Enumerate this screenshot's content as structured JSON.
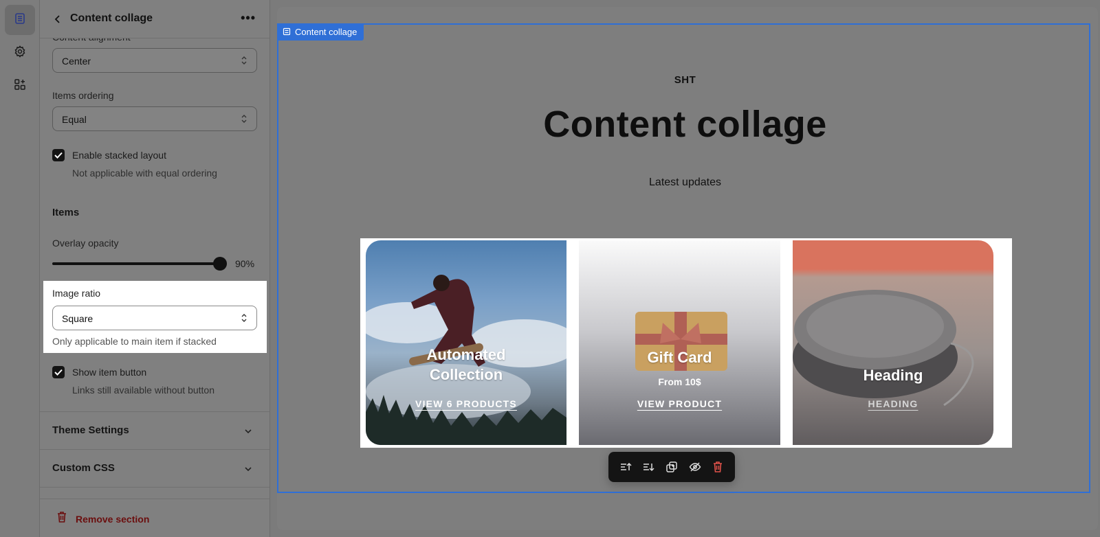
{
  "rail": {
    "items": [
      {
        "name": "sections-icon",
        "active": true
      },
      {
        "name": "settings-gear-icon",
        "active": false
      },
      {
        "name": "apps-icon",
        "active": false
      }
    ]
  },
  "panel": {
    "title": "Content collage",
    "cut_label": "Content alignment",
    "content_alignment": {
      "value": "Center"
    },
    "items_ordering": {
      "label": "Items ordering",
      "value": "Equal"
    },
    "stacked_layout": {
      "label": "Enable stacked layout",
      "help": "Not applicable with equal ordering",
      "checked": true
    },
    "items_section": "Items",
    "overlay_opacity": {
      "label": "Overlay opacity",
      "value_text": "90%",
      "value": 0.9
    },
    "image_ratio": {
      "label": "Image ratio",
      "value": "Square",
      "help": "Only applicable to main item if stacked"
    },
    "show_item_button": {
      "label": "Show item button",
      "help": "Links still available without button",
      "checked": true
    },
    "theme_settings": "Theme Settings",
    "custom_css": "Custom CSS",
    "remove_section": "Remove section"
  },
  "preview": {
    "section_tag": "Content collage",
    "subheading": "SHT",
    "heading": "Content collage",
    "description": "Latest updates",
    "cards": [
      {
        "title_line1": "Automated",
        "title_line2": "Collection",
        "link": "VIEW 6 PRODUCTS"
      },
      {
        "title": "Gift Card",
        "subtitle": "From 10$",
        "link": "VIEW PRODUCT"
      },
      {
        "title": "Heading",
        "link": "HEADING"
      }
    ]
  },
  "colors": {
    "selection_blue": "#2f6fd6",
    "remove_red": "#6b0e0e",
    "toolbar_bg": "#141414"
  }
}
